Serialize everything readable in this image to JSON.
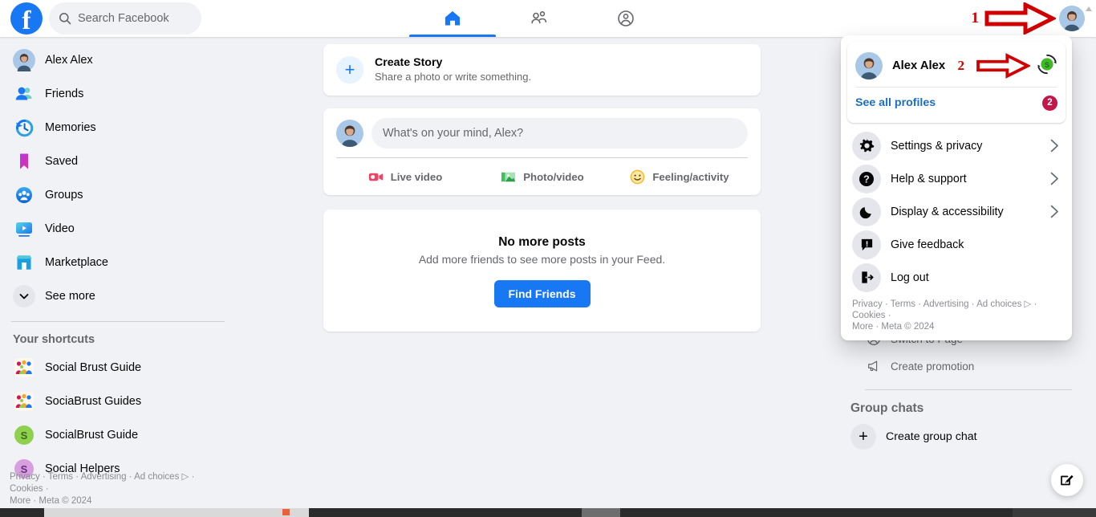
{
  "app": {
    "title": "Facebook",
    "logo_letter": "f",
    "copyright_year": "2024"
  },
  "search": {
    "placeholder": "Search Facebook",
    "icon": "search-icon"
  },
  "nav": {
    "tabs": [
      {
        "label": "Home",
        "icon": "home-icon",
        "active": true
      },
      {
        "label": "Friends",
        "icon": "friends-icon",
        "active": false
      },
      {
        "label": "Groups",
        "icon": "groups-icon",
        "active": false
      }
    ]
  },
  "annotations": [
    {
      "number": "1",
      "target": "profile-avatar-topbar",
      "color": "#d10000"
    },
    {
      "number": "2",
      "target": "profile-switch-badge",
      "color": "#d10000"
    }
  ],
  "sidebar": {
    "items": [
      {
        "label": "Alex Alex",
        "icon": "user-avatar-icon"
      },
      {
        "label": "Friends",
        "icon": "friends-icon"
      },
      {
        "label": "Memories",
        "icon": "clock-icon"
      },
      {
        "label": "Saved",
        "icon": "bookmark-icon"
      },
      {
        "label": "Groups",
        "icon": "groups-icon"
      },
      {
        "label": "Video",
        "icon": "video-icon"
      },
      {
        "label": "Marketplace",
        "icon": "storefront-icon"
      },
      {
        "label": "See more",
        "icon": "chevron-down-icon"
      }
    ],
    "shortcuts_title": "Your shortcuts",
    "shortcuts": [
      {
        "label": "Social Brust Guide",
        "icon": "group-photo-icon",
        "badge": ""
      },
      {
        "label": "SociaBrust Guides",
        "icon": "group-photo-icon",
        "badge": ""
      },
      {
        "label": "SocialBrust Guide",
        "icon": "letter-avatar-icon",
        "letter": "S",
        "color": "#8fd14f"
      },
      {
        "label": "Social Helpers",
        "icon": "letter-avatar-icon",
        "letter": "S",
        "color": "#d79fe0"
      }
    ],
    "footer_line1": "Privacy · Terms · Advertising · Ad choices ▷ · Cookies ·",
    "footer_line2": "More · Meta © 2024"
  },
  "feed": {
    "story": {
      "title": "Create Story",
      "subtitle": "Share a photo or write something.",
      "plus_icon": "plus-icon"
    },
    "composer": {
      "placeholder": "What's on your mind, Alex?",
      "actions": [
        {
          "label": "Live video",
          "icon": "live-video-icon",
          "color": "#f3425f"
        },
        {
          "label": "Photo/video",
          "icon": "photo-video-icon",
          "color": "#45bd62"
        },
        {
          "label": "Feeling/activity",
          "icon": "feeling-activity-icon",
          "color": "#f7b928"
        }
      ]
    },
    "empty_state": {
      "title": "No more posts",
      "subtitle": "Add more friends to see more posts in your Feed.",
      "button": "Find Friends",
      "button_color": "#1877f2"
    }
  },
  "right_column": {
    "items": [
      {
        "label": "Switch to Page",
        "icon": "switch-page-icon"
      },
      {
        "label": "Create promotion",
        "icon": "megaphone-icon"
      }
    ],
    "group_chats_title": "Group chats",
    "create_group_chat": "Create group chat",
    "plus_icon": "plus-icon"
  },
  "dropdown": {
    "profile": {
      "name": "Alex Alex",
      "avatar_icon": "user-avatar-icon",
      "switch_badge_letter": "S",
      "switch_badge_color": "#42b72a",
      "switch_icon": "switch-profile-icon"
    },
    "see_all_profiles": "See all profiles",
    "see_all_badge": "2",
    "menu_items": [
      {
        "label": "Settings & privacy",
        "icon": "gear-icon",
        "chevron": true
      },
      {
        "label": "Help & support",
        "icon": "question-circle-icon",
        "chevron": true
      },
      {
        "label": "Display & accessibility",
        "icon": "moon-icon",
        "chevron": true
      },
      {
        "label": "Give feedback",
        "icon": "feedback-icon",
        "chevron": false
      },
      {
        "label": "Log out",
        "icon": "logout-icon",
        "chevron": false
      }
    ],
    "footer_line1": "Privacy · Terms · Advertising · Ad choices ▷ · Cookies ·",
    "footer_line2": "More · Meta © 2024"
  },
  "fab": {
    "icon": "compose-pencil-icon"
  }
}
